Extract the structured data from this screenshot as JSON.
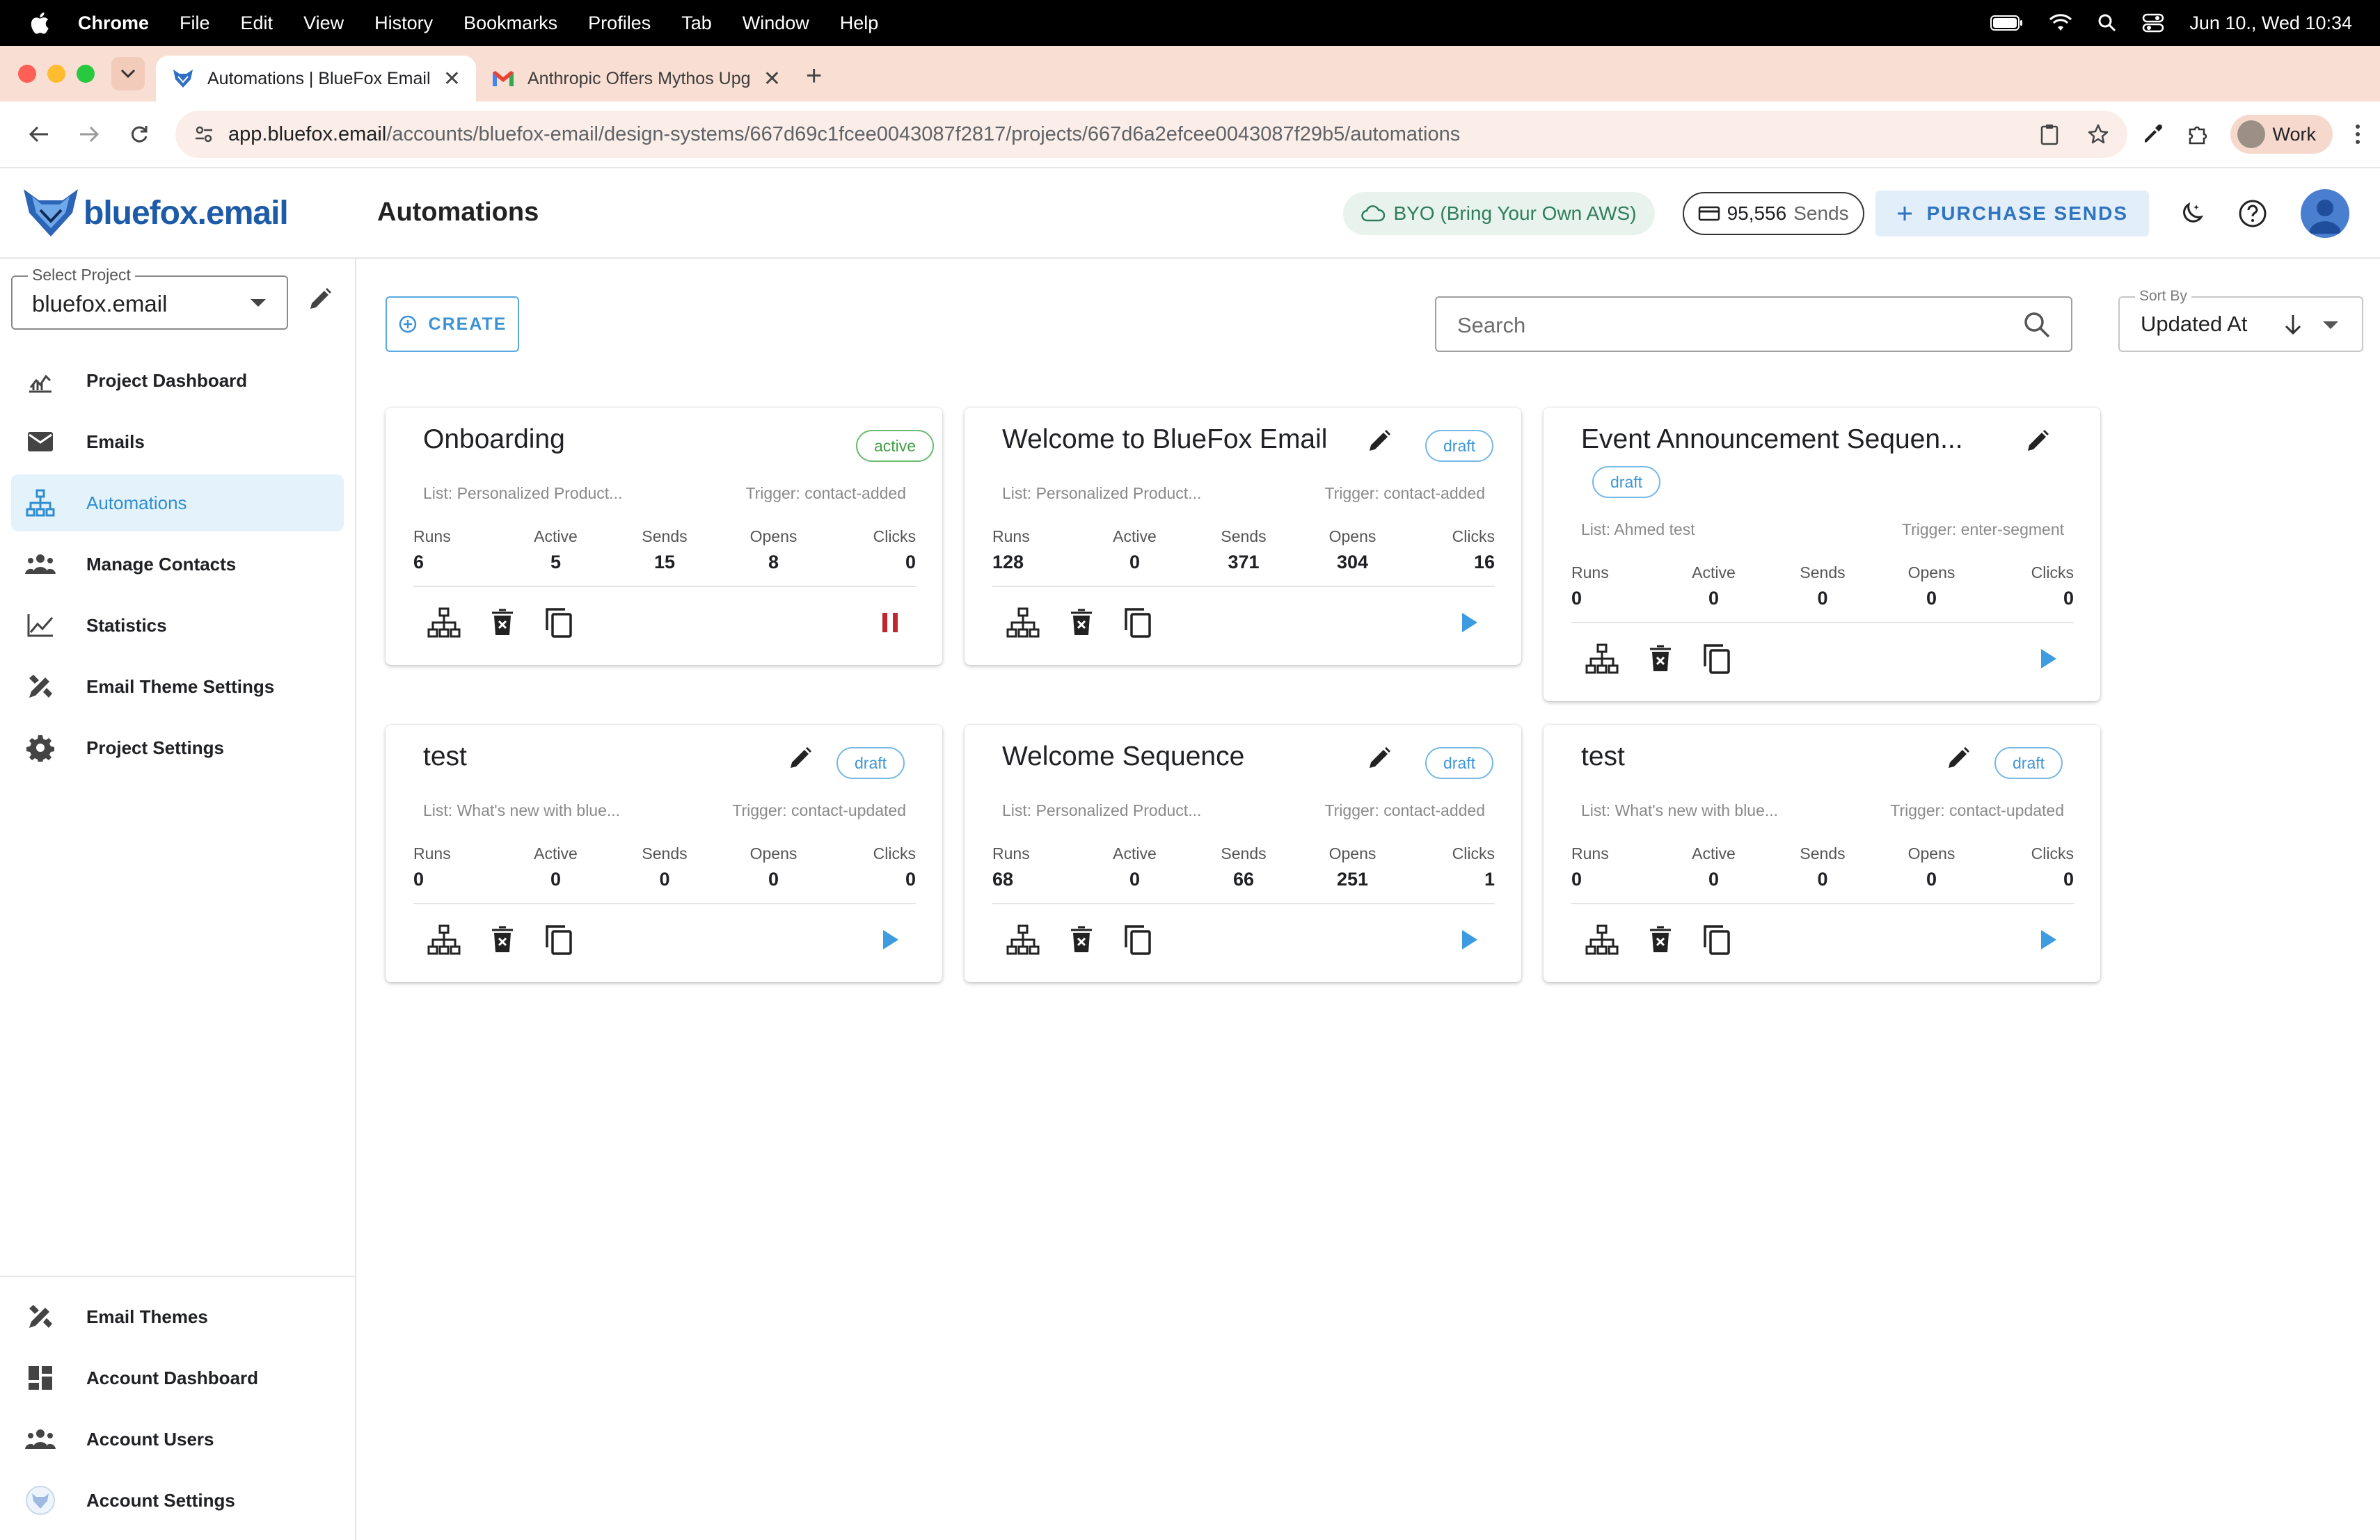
{
  "menubar": {
    "app": "Chrome",
    "items": [
      "File",
      "Edit",
      "View",
      "History",
      "Bookmarks",
      "Profiles",
      "Tab",
      "Window",
      "Help"
    ],
    "clock": "Jun 10., Wed  10:34"
  },
  "tabs": [
    {
      "title": "Automations | BlueFox Email",
      "active": true
    },
    {
      "title": "Anthropic Offers Mythos Upg",
      "active": false
    }
  ],
  "toolbar": {
    "url_host": "app.bluefox.email",
    "url_path": "/accounts/bluefox-email/design-systems/667d69c1fcee0043087f2817/projects/667d6a2efcee0043087f29b5/automations",
    "profile_label": "Work"
  },
  "header": {
    "logo_text": "bluefox.email",
    "page_title": "Automations",
    "byo_label": "BYO (Bring Your Own AWS)",
    "sends_count": "95,556",
    "sends_unit": "Sends",
    "purchase_label": "PURCHASE SENDS"
  },
  "sidebar": {
    "project_label": "Select Project",
    "project_value": "bluefox.email",
    "items": [
      {
        "label": "Project Dashboard",
        "icon": "dashboard-chart-icon"
      },
      {
        "label": "Emails",
        "icon": "mail-icon"
      },
      {
        "label": "Automations",
        "icon": "sitemap-icon",
        "active": true
      },
      {
        "label": "Manage Contacts",
        "icon": "people-icon"
      },
      {
        "label": "Statistics",
        "icon": "line-chart-icon"
      },
      {
        "label": "Email Theme Settings",
        "icon": "design-tools-icon"
      },
      {
        "label": "Project Settings",
        "icon": "gear-icon"
      }
    ],
    "bottom_items": [
      {
        "label": "Email Themes",
        "icon": "design-tools-icon"
      },
      {
        "label": "Account Dashboard",
        "icon": "grid-dashboard-icon"
      },
      {
        "label": "Account Users",
        "icon": "people-icon"
      },
      {
        "label": "Account Settings",
        "icon": "fox-logo-icon"
      }
    ]
  },
  "controls": {
    "create_label": "CREATE",
    "search_placeholder": "Search",
    "sort_label": "Sort By",
    "sort_value": "Updated At"
  },
  "stat_labels": [
    "Runs",
    "Active",
    "Sends",
    "Opens",
    "Clicks"
  ],
  "automations": [
    {
      "name": "Onboarding",
      "status": "active",
      "list": "List: Personalized Product...",
      "trigger": "Trigger: contact-added",
      "stats": [
        "6",
        "5",
        "15",
        "8",
        "0"
      ],
      "editable": false,
      "running": true
    },
    {
      "name": "Welcome to BlueFox Email",
      "status": "draft",
      "list": "List: Personalized Product...",
      "trigger": "Trigger: contact-added",
      "stats": [
        "128",
        "0",
        "371",
        "304",
        "16"
      ],
      "editable": true,
      "running": false
    },
    {
      "name": "Event Announcement Sequen...",
      "status": "draft",
      "list": "List: Ahmed test",
      "trigger": "Trigger: enter-segment",
      "stats": [
        "0",
        "0",
        "0",
        "0",
        "0"
      ],
      "editable": true,
      "running": false
    },
    {
      "name": "test",
      "status": "draft",
      "list": "List: What's new with blue...",
      "trigger": "Trigger: contact-updated",
      "stats": [
        "0",
        "0",
        "0",
        "0",
        "0"
      ],
      "editable": true,
      "running": false
    },
    {
      "name": "Welcome Sequence",
      "status": "draft",
      "list": "List: Personalized Product...",
      "trigger": "Trigger: contact-added",
      "stats": [
        "68",
        "0",
        "66",
        "251",
        "1"
      ],
      "editable": true,
      "running": false
    },
    {
      "name": "test",
      "status": "draft",
      "list": "List: What's new with blue...",
      "trigger": "Trigger: contact-updated",
      "stats": [
        "0",
        "0",
        "0",
        "0",
        "0"
      ],
      "editable": true,
      "running": false
    }
  ],
  "colors": {
    "accent": "#3b91d4",
    "active_green": "#43a047",
    "pause_red": "#c0282d",
    "play_blue": "#3d9be0"
  }
}
